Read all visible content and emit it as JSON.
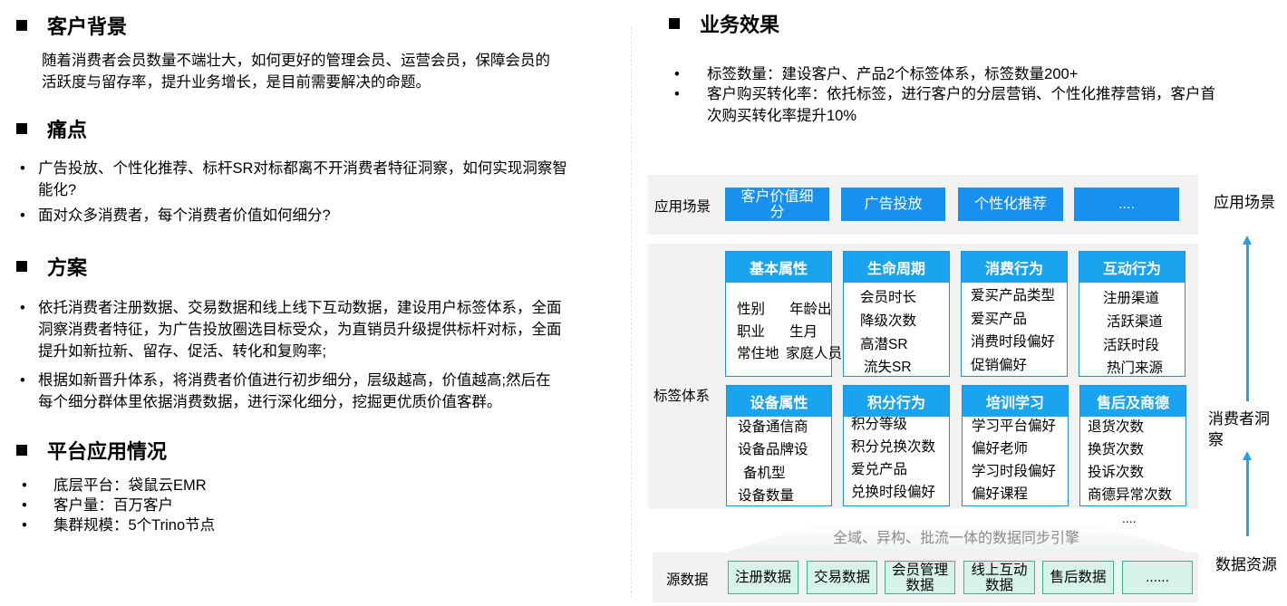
{
  "background": {
    "title": "客户背景",
    "lines": [
      "随着消费者会员数量不端壮大，如何更好的管理会员、运营会员，保障会员的",
      "活跃度与留存率，提升业务增长，是目前需要解决的命题。"
    ]
  },
  "pain": {
    "title": "痛点",
    "items": [
      {
        "lines": [
          "广告投放、个性化推荐、标杆SR对标都离不开消费者特征洞察，如何实现洞察智",
          "能化?"
        ]
      },
      {
        "lines": [
          "面对众多消费者，每个消费者价值如何细分?"
        ]
      }
    ]
  },
  "plan": {
    "title": "方案",
    "items": [
      {
        "lines": [
          "依托消费者注册数据、交易数据和线上线下互动数据，建设用户标签体系，全面",
          "洞察消费者特征，为广告投放圈选目标受众，为直销员升级提供标杆对标，全面",
          "提升如新拉新、留存、促活、转化和复购率;"
        ]
      },
      {
        "lines": [
          "根据如新晋升体系，将消费者价值进行初步细分，层级越高，价值越高;然后在",
          "每个细分群体里依据消费数据，进行深化细分，挖掘更优质价值客群。"
        ]
      }
    ]
  },
  "platform": {
    "title": "平台应用情况",
    "items": [
      "底层平台：袋鼠云EMR",
      "客户量：百万客户",
      "集群规模：5个Trino节点"
    ]
  },
  "effect": {
    "title": "业务效果",
    "items": [
      {
        "lines": [
          "标签数量：建设客户、产品2个标签体系，标签数量200+"
        ]
      },
      {
        "lines": [
          "客户购买转化率：依托标签，进行客户的分层营销、个性化推荐营销，客户首",
          "次购买转化率提升10%"
        ]
      }
    ]
  },
  "diagram": {
    "scene_label": "应用场景",
    "scenes": [
      [
        "客户价值细",
        "分"
      ],
      [
        "广告投放"
      ],
      [
        "个性化推荐"
      ],
      [
        "...."
      ]
    ],
    "tag_label": "标签体系",
    "cards": [
      {
        "title": "基本属性",
        "items": [
          "性别",
          "年龄出",
          "职业",
          "生月",
          "常住地",
          "家庭人员"
        ]
      },
      {
        "title": "生命周期",
        "items": [
          "会员时长",
          "降级次数",
          "高潜SR",
          "流失SR"
        ]
      },
      {
        "title": "消费行为",
        "items": [
          "爱买产品类型",
          "爱买产品",
          "消费时段偏好",
          "促销偏好"
        ]
      },
      {
        "title": "互动行为",
        "items": [
          "注册渠道",
          "活跃渠道",
          "活跃时段",
          "热门来源"
        ]
      },
      {
        "title": "设备属性",
        "items": [
          "设备通信商",
          "设备品牌设",
          "备机型",
          "设备数量"
        ]
      },
      {
        "title": "积分行为",
        "items": [
          "积分等级",
          "积分兑换次数",
          "爱兑产品",
          "兑换时段偏好"
        ]
      },
      {
        "title": "培训学习",
        "items": [
          "学习平台偏好",
          "偏好老师",
          "学习时段偏好",
          "偏好课程"
        ]
      },
      {
        "title": "售后及商德",
        "items": [
          "退货次数",
          "换货次数",
          "投诉次数",
          "商德异常次数"
        ]
      }
    ],
    "more": "....",
    "engine": "全域、异构、批流一体的数据同步引擎",
    "source_label": "源数据",
    "sources": [
      [
        "注册数据"
      ],
      [
        "交易数据"
      ],
      [
        "会员管理",
        "数据"
      ],
      [
        "线上互动",
        "数据"
      ],
      [
        "售后数据"
      ],
      [
        "......"
      ]
    ],
    "side_top": "应用场景",
    "side_mid": [
      "消费者洞",
      "察"
    ],
    "side_bottom": "数据资源",
    "colors": {
      "scene": "#1890f0",
      "card_head": "#1aa3ef",
      "source_fill": "#d6f3e9",
      "source_border": "#35b98a",
      "arrow": "#2b9de6"
    }
  }
}
